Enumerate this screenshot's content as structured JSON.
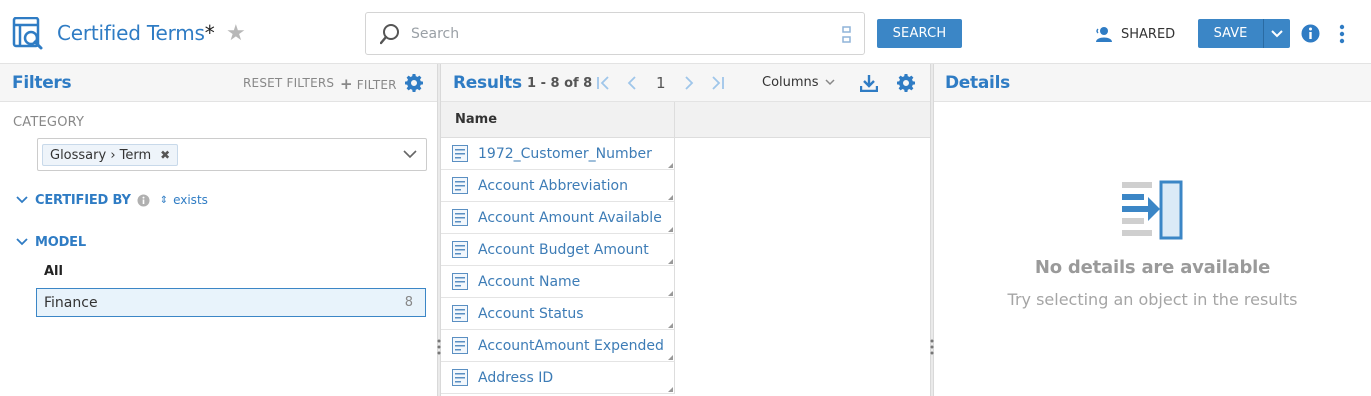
{
  "header": {
    "title": "Certified Terms",
    "dirty_marker": "*",
    "search_placeholder": "Search",
    "search_button": "SEARCH",
    "shared_label": "SHARED",
    "save_label": "SAVE"
  },
  "filters": {
    "title": "Filters",
    "reset_label": "RESET FILTERS",
    "add_filter_label": "FILTER",
    "category_label": "CATEGORY",
    "category_chip": "Glossary › Term",
    "certified_by_label": "CERTIFIED BY",
    "certified_by_value": "exists",
    "model_label": "MODEL",
    "model_all": "All",
    "model_selected": {
      "name": "Finance",
      "count": "8"
    }
  },
  "results": {
    "title": "Results",
    "range": "1 - 8 of 8",
    "page": "1",
    "columns_label": "Columns",
    "column_header": "Name",
    "rows": [
      "1972_Customer_Number",
      "Account Abbreviation",
      "Account Amount Available",
      "Account Budget Amount",
      "Account Name",
      "Account Status",
      "AccountAmount Expended",
      "Address ID"
    ]
  },
  "details": {
    "title": "Details",
    "empty_title": "No details are available",
    "empty_subtitle": "Try selecting an object in the results"
  },
  "colors": {
    "accent": "#2f7cc4",
    "button": "#3b86c6",
    "selection_bg": "#e8f3fb"
  }
}
